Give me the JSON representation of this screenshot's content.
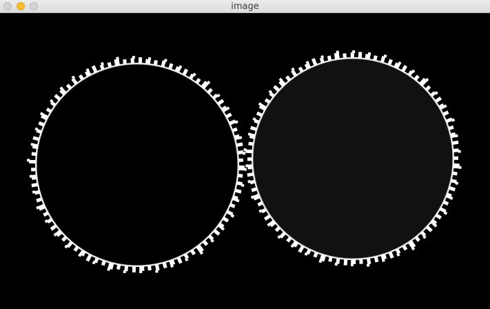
{
  "window": {
    "title": "image",
    "controls": [
      "close-icon",
      "minimize-icon",
      "zoom-icon"
    ],
    "colors": {
      "titlebar": "#e6e6e6",
      "minimize": "#f6be2f",
      "inactive_control": "#d3d3d3",
      "canvas_background": "#000000"
    }
  },
  "image": {
    "description_type": "binary-image",
    "objects": [
      {
        "name": "left-gear",
        "fill": "#000000",
        "outline": "#ffffff"
      },
      {
        "name": "right-gear",
        "fill": "#111111",
        "outline": "#ffffff"
      }
    ]
  }
}
